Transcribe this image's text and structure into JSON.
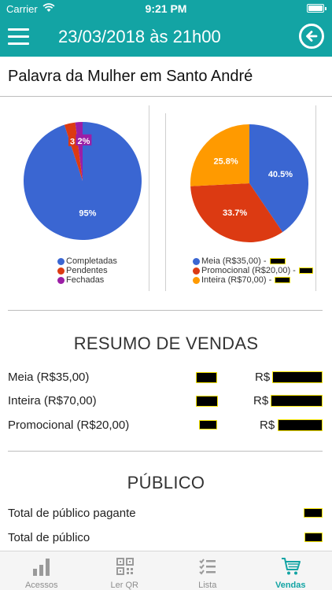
{
  "status_bar": {
    "carrier": "Carrier",
    "time": "9:21 PM"
  },
  "header": {
    "title": "23/03/2018 às 21h00"
  },
  "event": {
    "title": "Palavra da Mulher em Santo André"
  },
  "colors": {
    "accent": "#13a4a4",
    "blue": "#3a66d2",
    "red": "#dc3a12",
    "purple": "#9b1ea6",
    "orange": "#ff9a00"
  },
  "chart_data": [
    {
      "type": "pie",
      "labels": [
        "Completadas",
        "Pendentes",
        "Fechadas"
      ],
      "values": [
        95,
        3,
        2
      ],
      "colors": [
        "#3a66d2",
        "#dc3a12",
        "#9b1ea6"
      ],
      "data_labels": [
        "95%",
        "3",
        "2%"
      ],
      "legend": "bottom-left"
    },
    {
      "type": "pie",
      "labels": [
        "Meia (R$35,00) -",
        "Promocional (R$20,00) -",
        "Inteira (R$70,00) -"
      ],
      "values": [
        40.5,
        33.7,
        25.8
      ],
      "colors": [
        "#3a66d2",
        "#dc3a12",
        "#ff9a00"
      ],
      "data_labels": [
        "40.5%",
        "33.7%",
        "25.8%"
      ],
      "legend": "bottom-left"
    }
  ],
  "sales": {
    "heading": "RESUMO DE VENDAS",
    "currency": "R$",
    "rows": [
      {
        "label": "Meia (R$35,00)"
      },
      {
        "label": "Inteira (R$70,00)"
      },
      {
        "label": "Promocional (R$20,00)"
      }
    ]
  },
  "public": {
    "heading": "PÚBLICO",
    "rows": [
      {
        "label": "Total de público pagante"
      },
      {
        "label": "Total de público"
      }
    ]
  },
  "tabs": [
    {
      "label": "Acessos",
      "icon": "bar-chart-icon",
      "active": false
    },
    {
      "label": "Ler QR",
      "icon": "qr-code-icon",
      "active": false
    },
    {
      "label": "Lista",
      "icon": "checklist-icon",
      "active": false
    },
    {
      "label": "Vendas",
      "icon": "shopping-cart-icon",
      "active": true
    }
  ]
}
